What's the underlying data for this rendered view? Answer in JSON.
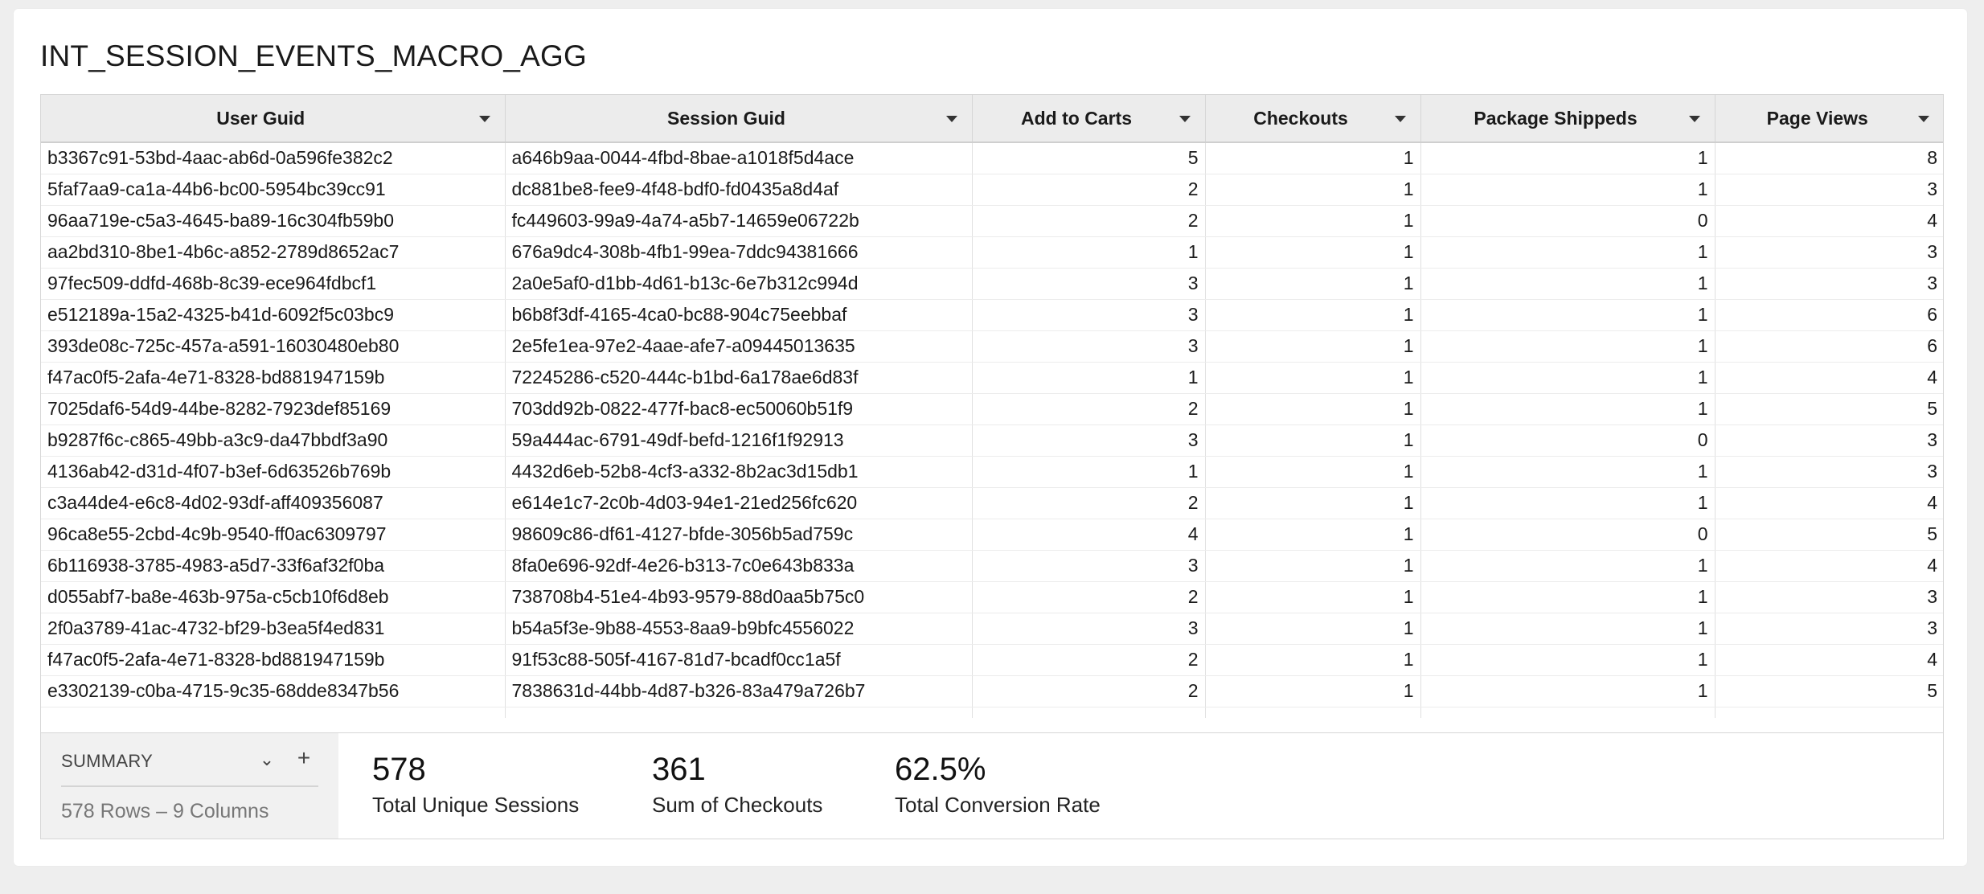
{
  "title": "INT_SESSION_EVENTS_MACRO_AGG",
  "table": {
    "columns": [
      "User Guid",
      "Session Guid",
      "Add to Carts",
      "Checkouts",
      "Package Shippeds",
      "Page Views"
    ],
    "rows": [
      [
        "b3367c91-53bd-4aac-ab6d-0a596fe382c2",
        "a646b9aa-0044-4fbd-8bae-a1018f5d4ace",
        "5",
        "1",
        "1",
        "8"
      ],
      [
        "5faf7aa9-ca1a-44b6-bc00-5954bc39cc91",
        "dc881be8-fee9-4f48-bdf0-fd0435a8d4af",
        "2",
        "1",
        "1",
        "3"
      ],
      [
        "96aa719e-c5a3-4645-ba89-16c304fb59b0",
        "fc449603-99a9-4a74-a5b7-14659e06722b",
        "2",
        "1",
        "0",
        "4"
      ],
      [
        "aa2bd310-8be1-4b6c-a852-2789d8652ac7",
        "676a9dc4-308b-4fb1-99ea-7ddc94381666",
        "1",
        "1",
        "1",
        "3"
      ],
      [
        "97fec509-ddfd-468b-8c39-ece964fdbcf1",
        "2a0e5af0-d1bb-4d61-b13c-6e7b312c994d",
        "3",
        "1",
        "1",
        "3"
      ],
      [
        "e512189a-15a2-4325-b41d-6092f5c03bc9",
        "b6b8f3df-4165-4ca0-bc88-904c75eebbaf",
        "3",
        "1",
        "1",
        "6"
      ],
      [
        "393de08c-725c-457a-a591-16030480eb80",
        "2e5fe1ea-97e2-4aae-afe7-a09445013635",
        "3",
        "1",
        "1",
        "6"
      ],
      [
        "f47ac0f5-2afa-4e71-8328-bd881947159b",
        "72245286-c520-444c-b1bd-6a178ae6d83f",
        "1",
        "1",
        "1",
        "4"
      ],
      [
        "7025daf6-54d9-44be-8282-7923def85169",
        "703dd92b-0822-477f-bac8-ec50060b51f9",
        "2",
        "1",
        "1",
        "5"
      ],
      [
        "b9287f6c-c865-49bb-a3c9-da47bbdf3a90",
        "59a444ac-6791-49df-befd-1216f1f92913",
        "3",
        "1",
        "0",
        "3"
      ],
      [
        "4136ab42-d31d-4f07-b3ef-6d63526b769b",
        "4432d6eb-52b8-4cf3-a332-8b2ac3d15db1",
        "1",
        "1",
        "1",
        "3"
      ],
      [
        "c3a44de4-e6c8-4d02-93df-aff409356087",
        "e614e1c7-2c0b-4d03-94e1-21ed256fc620",
        "2",
        "1",
        "1",
        "4"
      ],
      [
        "96ca8e55-2cbd-4c9b-9540-ff0ac6309797",
        "98609c86-df61-4127-bfde-3056b5ad759c",
        "4",
        "1",
        "0",
        "5"
      ],
      [
        "6b116938-3785-4983-a5d7-33f6af32f0ba",
        "8fa0e696-92df-4e26-b313-7c0e643b833a",
        "3",
        "1",
        "1",
        "4"
      ],
      [
        "d055abf7-ba8e-463b-975a-c5cb10f6d8eb",
        "738708b4-51e4-4b93-9579-88d0aa5b75c0",
        "2",
        "1",
        "1",
        "3"
      ],
      [
        "2f0a3789-41ac-4732-bf29-b3ea5f4ed831",
        "b54a5f3e-9b88-4553-8aa9-b9bfc4556022",
        "3",
        "1",
        "1",
        "3"
      ],
      [
        "f47ac0f5-2afa-4e71-8328-bd881947159b",
        "91f53c88-505f-4167-81d7-bcadf0cc1a5f",
        "2",
        "1",
        "1",
        "4"
      ],
      [
        "e3302139-c0ba-4715-9c35-68dde8347b56",
        "7838631d-44bb-4d87-b326-83a479a726b7",
        "2",
        "1",
        "1",
        "5"
      ]
    ]
  },
  "summary": {
    "label": "SUMMARY",
    "rows_text": "578 Rows – 9 Columns",
    "chevron_icon": "chevron-down-icon",
    "add_icon": "plus-icon",
    "metrics": [
      {
        "value": "578",
        "label": "Total Unique Sessions"
      },
      {
        "value": "361",
        "label": "Sum of Checkouts"
      },
      {
        "value": "62.5%",
        "label": "Total Conversion Rate"
      }
    ]
  }
}
